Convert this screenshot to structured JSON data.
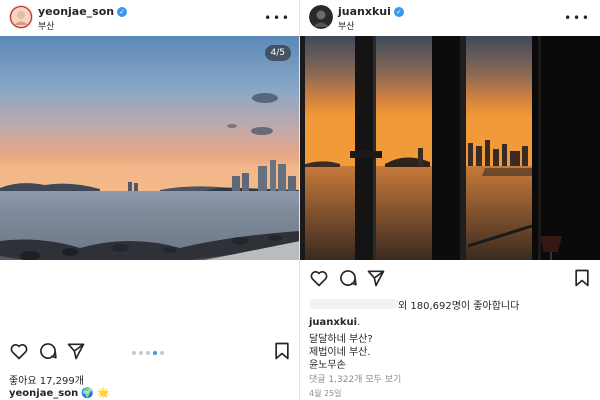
{
  "left_post": {
    "username": "yeonjae_son",
    "location": "부산",
    "carousel_counter": "4/5",
    "carousel_dots": 5,
    "carousel_active_index": 3,
    "likes_text": "좋아요 17,299개",
    "caption_username": "yeonjae_son",
    "caption_emoji": "🌍 🌟",
    "icons": [
      "heart-icon",
      "comment-icon",
      "share-icon",
      "bookmark-icon"
    ]
  },
  "right_post": {
    "username": "juanxkui",
    "location": "부산",
    "likes_suffix": "외 180,692명이 좋아합니다",
    "caption_username": "juanxkui",
    "caption_username_suffix": ".",
    "caption_lines": [
      "달달하네 부산?",
      "제법이네 부산.",
      "윤노무손"
    ],
    "comments_link": "댓글 1,322개 모두 보기",
    "date": "4월 25일",
    "icons": [
      "heart-icon",
      "comment-icon",
      "share-icon",
      "bookmark-icon"
    ]
  },
  "colors": {
    "verified": "#3897f0",
    "active_dot": "#3897f0",
    "muted_text": "#8e8e8e"
  }
}
